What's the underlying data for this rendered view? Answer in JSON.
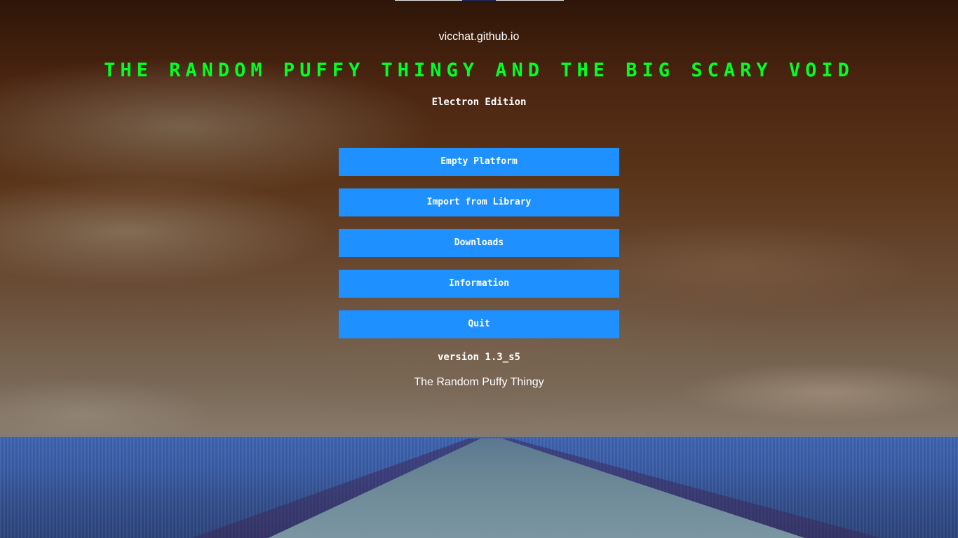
{
  "header": {
    "site_link": "vicchat.github.io",
    "title": "The Random Puffy Thingy and the Big Scary Void",
    "edition": "Electron Edition"
  },
  "menu": {
    "items": [
      {
        "label": "Empty Platform"
      },
      {
        "label": "Import from Library"
      },
      {
        "label": "Downloads"
      },
      {
        "label": "Information"
      },
      {
        "label": "Quit"
      }
    ]
  },
  "footer": {
    "version": "version 1.3_s5",
    "name": "The Random Puffy Thingy"
  },
  "colors": {
    "title": "#00ff22",
    "button": "#1e90ff",
    "text": "#ffffff"
  },
  "background": {
    "scene": "orange sky over blue field with road"
  }
}
